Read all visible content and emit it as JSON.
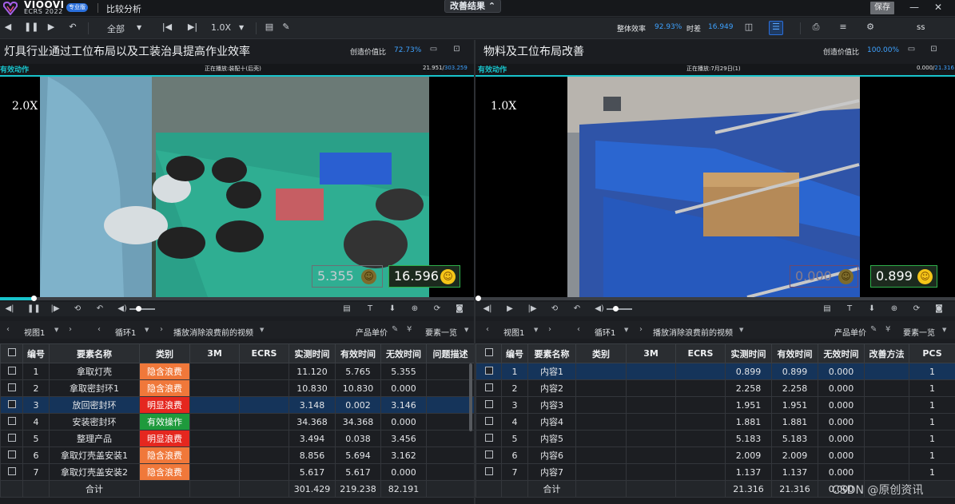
{
  "app": {
    "logo": "VIOOVI",
    "logo_sub": "ECRS 2022",
    "edition": "专业版",
    "window_title": "比较分析",
    "center_tab": "改善结果",
    "save": "保存",
    "minimize": "—",
    "close": "✕"
  },
  "toolbar": {
    "filter": "全部",
    "speed": "1.0X",
    "overall_eff_label": "整体效率",
    "overall_eff_value": "92.93%",
    "time_diff_label": "时差",
    "time_diff_value": "16.949",
    "user": "ss"
  },
  "left": {
    "title": "灯具行业通过工位布局以及工装治具提高作业效率",
    "cv_label": "创造价值比",
    "cv_value": "72.73%",
    "effective_label": "有效动作",
    "playing": "正在播放:装配十(后壳)",
    "time_cur": "21.951/",
    "time_total": "303.259",
    "speed": "2.0X",
    "score_left": "5.355",
    "score_right": "16.596",
    "progress": 0.07,
    "nav": {
      "view": "视图1",
      "loop": "循环1",
      "playmode": "播放消除浪费前的视频",
      "unit_price": "产品单价",
      "overview": "要素一览"
    },
    "headers": [
      "编号",
      "要素名称",
      "类别",
      "3M",
      "ECRS",
      "实测时间",
      "有效时间",
      "无效时间",
      "问题描述"
    ],
    "rows": [
      {
        "no": "1",
        "name": "拿取灯壳",
        "cat": "隐含浪费",
        "cat_type": "o",
        "m3": "",
        "ecrs": "",
        "meas": "11.120",
        "eff": "5.765",
        "ineff": "5.355",
        "desc": ""
      },
      {
        "no": "2",
        "name": "拿取密封环1",
        "cat": "隐含浪费",
        "cat_type": "o",
        "m3": "",
        "ecrs": "",
        "meas": "10.830",
        "eff": "10.830",
        "ineff": "0.000",
        "desc": ""
      },
      {
        "no": "3",
        "name": "放回密封环",
        "cat": "明显浪费",
        "cat_type": "r",
        "m3": "",
        "ecrs": "",
        "meas": "3.148",
        "eff": "0.002",
        "ineff": "3.146",
        "desc": "",
        "selected": true
      },
      {
        "no": "4",
        "name": "安装密封环",
        "cat": "有效操作",
        "cat_type": "g",
        "m3": "",
        "ecrs": "",
        "meas": "34.368",
        "eff": "34.368",
        "ineff": "0.000",
        "desc": ""
      },
      {
        "no": "5",
        "name": "整理产品",
        "cat": "明显浪费",
        "cat_type": "r",
        "m3": "",
        "ecrs": "",
        "meas": "3.494",
        "eff": "0.038",
        "ineff": "3.456",
        "desc": ""
      },
      {
        "no": "6",
        "name": "拿取灯壳盖安装1",
        "cat": "隐含浪费",
        "cat_type": "o",
        "m3": "",
        "ecrs": "",
        "meas": "8.856",
        "eff": "5.694",
        "ineff": "3.162",
        "desc": ""
      },
      {
        "no": "7",
        "name": "拿取灯壳盖安装2",
        "cat": "隐含浪费",
        "cat_type": "o",
        "m3": "",
        "ecrs": "",
        "meas": "5.617",
        "eff": "5.617",
        "ineff": "0.000",
        "desc": ""
      }
    ],
    "total": {
      "label": "合计",
      "meas": "301.429",
      "eff": "219.238",
      "ineff": "82.191"
    }
  },
  "right": {
    "title": "物料及工位布局改善",
    "cv_label": "创造价值比",
    "cv_value": "100.00%",
    "effective_label": "有效动作",
    "playing": "正在播放:7月29日(1)",
    "time_cur": "0.000/",
    "time_total": "21.316",
    "speed": "1.0X",
    "score_left": "0.000",
    "score_right": "0.899",
    "progress": 0.0,
    "nav": {
      "view": "视图1",
      "loop": "循环1",
      "playmode": "播放消除浪费前的视频",
      "unit_price": "产品单价",
      "overview": "要素一览"
    },
    "headers": [
      "编号",
      "要素名称",
      "类别",
      "3M",
      "ECRS",
      "实测时间",
      "有效时间",
      "无效时间",
      "改善方法",
      "PCS"
    ],
    "rows": [
      {
        "no": "1",
        "name": "内容1",
        "meas": "0.899",
        "eff": "0.899",
        "ineff": "0.000",
        "pcs": "1",
        "selected": true
      },
      {
        "no": "2",
        "name": "内容2",
        "meas": "2.258",
        "eff": "2.258",
        "ineff": "0.000",
        "pcs": "1"
      },
      {
        "no": "3",
        "name": "内容3",
        "meas": "1.951",
        "eff": "1.951",
        "ineff": "0.000",
        "pcs": "1"
      },
      {
        "no": "4",
        "name": "内容4",
        "meas": "1.881",
        "eff": "1.881",
        "ineff": "0.000",
        "pcs": "1"
      },
      {
        "no": "5",
        "name": "内容5",
        "meas": "5.183",
        "eff": "5.183",
        "ineff": "0.000",
        "pcs": "1"
      },
      {
        "no": "6",
        "name": "内容6",
        "meas": "2.009",
        "eff": "2.009",
        "ineff": "0.000",
        "pcs": "1"
      },
      {
        "no": "7",
        "name": "内容7",
        "meas": "1.137",
        "eff": "1.137",
        "ineff": "0.000",
        "pcs": "1"
      }
    ],
    "total": {
      "label": "合计",
      "meas": "21.316",
      "eff": "21.316",
      "ineff": "0.000"
    }
  },
  "watermark": "CSDN @原创资讯",
  "colors": {
    "accent": "#3ea2ff",
    "teal": "#18c4cc",
    "orange": "#f0783a",
    "red": "#e5271f",
    "green": "#1e9a3c"
  }
}
